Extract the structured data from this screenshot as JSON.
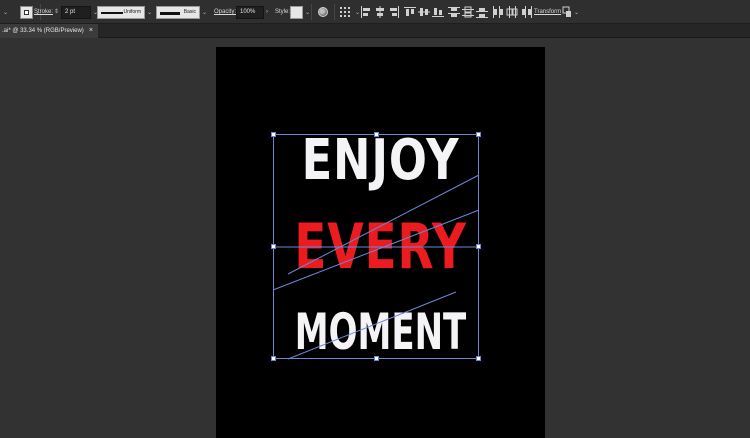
{
  "control_bar": {
    "stroke_label": "Stroke:",
    "stroke_weight": "2 pt",
    "profile_label": "Uniform",
    "brush_label": "Basic",
    "opacity_label": "Opacity:",
    "opacity_value": "100%",
    "style_label": "Style:",
    "transform_label": "Transform",
    "icons": [
      "shape-mode-icon",
      "globe-recolor-icon",
      "grid-icon",
      "align-left-icon",
      "align-hcenter-icon",
      "align-right-icon",
      "align-top-icon",
      "align-vcenter-icon",
      "align-bottom-icon",
      "distribute-top-icon",
      "distribute-vcenter-icon",
      "distribute-bottom-icon",
      "distribute-left-icon",
      "distribute-hcenter-icon",
      "distribute-right-icon",
      "isolate-icon"
    ]
  },
  "document_tab": {
    "title": ".ai* @ 33.34 % (RGB/Preview)",
    "close_glyph": "×"
  },
  "artwork": {
    "lines": [
      "ENJOY",
      "EVERY",
      "MOMENT"
    ],
    "colors": {
      "background": "#000000",
      "white_text": "#f4f4f6",
      "red_text": "#ea1c1f",
      "selection": "#6e86d8"
    }
  }
}
